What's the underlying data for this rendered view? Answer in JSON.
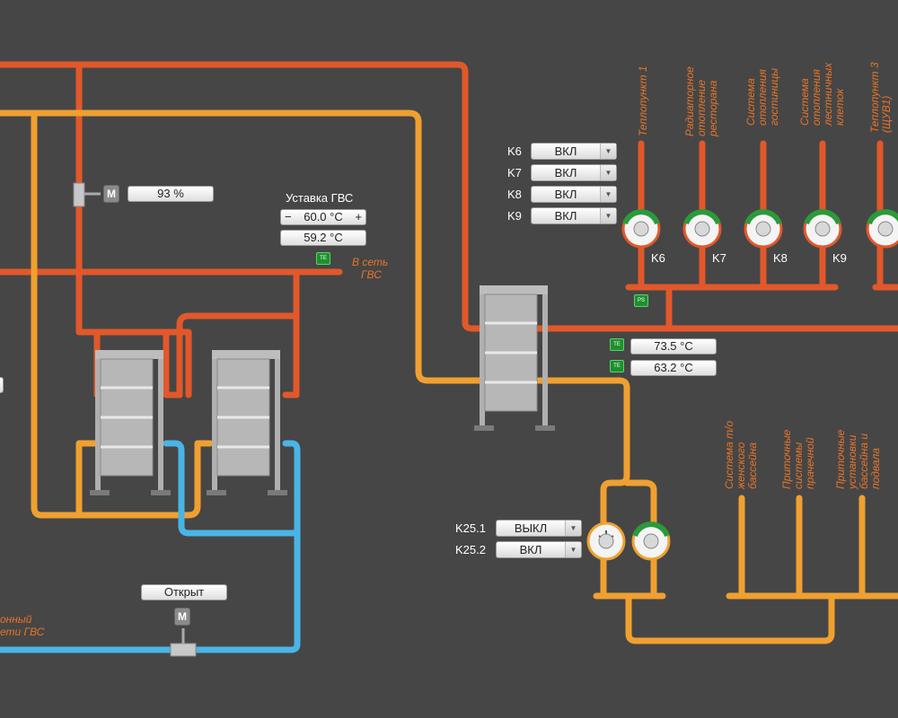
{
  "valve_position": {
    "value": "93 %"
  },
  "motor_label": "M",
  "dhw": {
    "setpoint_label": "Уставка ГВС",
    "setpoint_value": "60.0 °C",
    "minus": "−",
    "plus": "+",
    "current_temp": "59.2 °C",
    "network_label_line1": "В сеть",
    "network_label_line2": "ГВС"
  },
  "sensor_labels": {
    "te": "TE",
    "ps": "PS"
  },
  "temps": {
    "supply": "73.5 °C",
    "return": "63.2 °C"
  },
  "selectors": [
    {
      "label": "K6",
      "value": "ВКЛ"
    },
    {
      "label": "K7",
      "value": "ВКЛ"
    },
    {
      "label": "K8",
      "value": "ВКЛ"
    },
    {
      "label": "K9",
      "value": "ВКЛ"
    }
  ],
  "pump_labels": [
    "K6",
    "K7",
    "K8",
    "K9"
  ],
  "heating_consumers": [
    {
      "line1": "Теплопункт 1",
      "line2": ""
    },
    {
      "line1": "Радиаторное",
      "line2": "отопление",
      "line3": "ресторана"
    },
    {
      "line1": "Система",
      "line2": "отопления",
      "line3": "гостиницы"
    },
    {
      "line1": "Система",
      "line2": "отопления",
      "line3": "лестничных",
      "line4": "клеток"
    },
    {
      "line1": "Теплопункт 3",
      "line2": "(ЩУВ1)"
    }
  ],
  "pool_selectors": [
    {
      "label": "K25.1",
      "value": "ВЫКЛ"
    },
    {
      "label": "K25.2",
      "value": "ВКЛ"
    }
  ],
  "pool_consumers": [
    {
      "line1": "Система т/о",
      "line2": "женского",
      "line3": "бассейна"
    },
    {
      "line1": "Приточные",
      "line2": "системы",
      "line3": "прачечной"
    },
    {
      "line1": "Приточные",
      "line2": "установки",
      "line3": "бассейна и",
      "line4": "подвала"
    }
  ],
  "open_button": "Открыт",
  "bottom_left_label_line1": "онный",
  "bottom_left_label_line2": "ети ГВС",
  "colors": {
    "hot": "#e2582a",
    "warm": "#f0a030",
    "cold": "#4ab4e6",
    "background": "#464646"
  }
}
